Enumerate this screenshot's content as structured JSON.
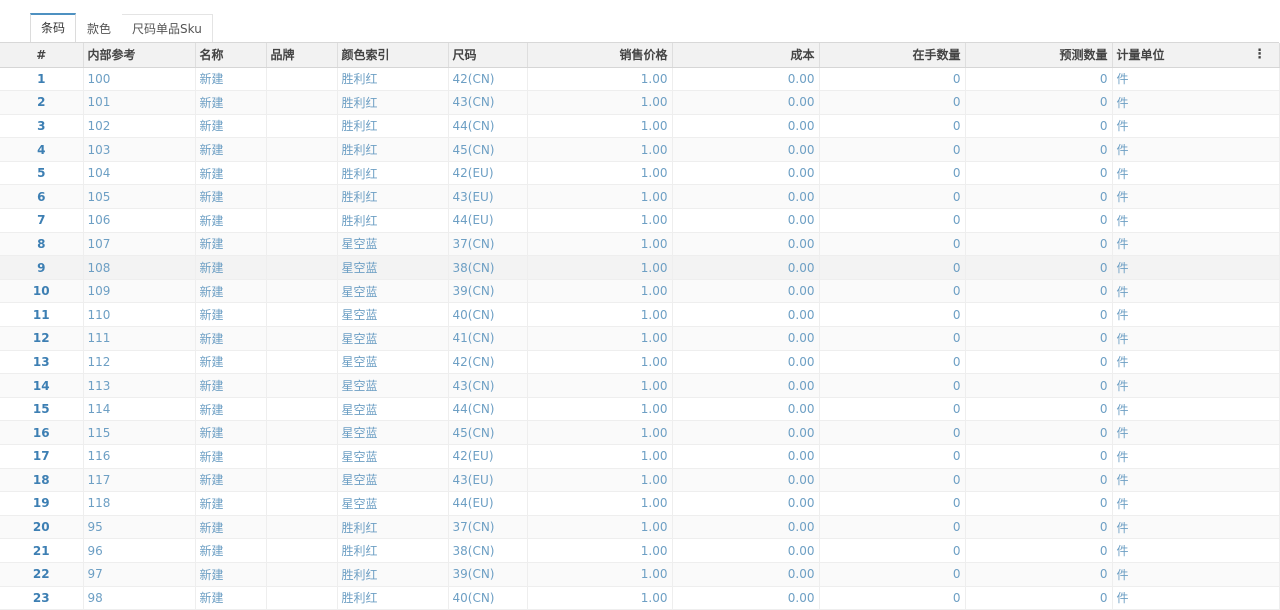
{
  "tabs": [
    {
      "label": "条码",
      "active": true
    },
    {
      "label": "款色",
      "active": false
    },
    {
      "label": "尺码单品Sku",
      "active": false
    }
  ],
  "columns": {
    "idx": "#",
    "ref": "内部参考",
    "name": "名称",
    "brand": "品牌",
    "color": "颜色索引",
    "size": "尺码",
    "price": "销售价格",
    "cost": "成本",
    "onhand": "在手数量",
    "forecast": "预测数量",
    "uom": "计量单位"
  },
  "menu_icon": "kebab-menu-icon",
  "rows": [
    {
      "idx": "1",
      "ref": "100",
      "name": "新建",
      "brand": "",
      "color": "胜利红",
      "size": "42(CN)",
      "price": "1.00",
      "cost": "0.00",
      "onhand": "0",
      "forecast": "0",
      "uom": "件"
    },
    {
      "idx": "2",
      "ref": "101",
      "name": "新建",
      "brand": "",
      "color": "胜利红",
      "size": "43(CN)",
      "price": "1.00",
      "cost": "0.00",
      "onhand": "0",
      "forecast": "0",
      "uom": "件"
    },
    {
      "idx": "3",
      "ref": "102",
      "name": "新建",
      "brand": "",
      "color": "胜利红",
      "size": "44(CN)",
      "price": "1.00",
      "cost": "0.00",
      "onhand": "0",
      "forecast": "0",
      "uom": "件"
    },
    {
      "idx": "4",
      "ref": "103",
      "name": "新建",
      "brand": "",
      "color": "胜利红",
      "size": "45(CN)",
      "price": "1.00",
      "cost": "0.00",
      "onhand": "0",
      "forecast": "0",
      "uom": "件"
    },
    {
      "idx": "5",
      "ref": "104",
      "name": "新建",
      "brand": "",
      "color": "胜利红",
      "size": "42(EU)",
      "price": "1.00",
      "cost": "0.00",
      "onhand": "0",
      "forecast": "0",
      "uom": "件"
    },
    {
      "idx": "6",
      "ref": "105",
      "name": "新建",
      "brand": "",
      "color": "胜利红",
      "size": "43(EU)",
      "price": "1.00",
      "cost": "0.00",
      "onhand": "0",
      "forecast": "0",
      "uom": "件"
    },
    {
      "idx": "7",
      "ref": "106",
      "name": "新建",
      "brand": "",
      "color": "胜利红",
      "size": "44(EU)",
      "price": "1.00",
      "cost": "0.00",
      "onhand": "0",
      "forecast": "0",
      "uom": "件"
    },
    {
      "idx": "8",
      "ref": "107",
      "name": "新建",
      "brand": "",
      "color": "星空蓝",
      "size": "37(CN)",
      "price": "1.00",
      "cost": "0.00",
      "onhand": "0",
      "forecast": "0",
      "uom": "件"
    },
    {
      "idx": "9",
      "ref": "108",
      "name": "新建",
      "brand": "",
      "color": "星空蓝",
      "size": "38(CN)",
      "price": "1.00",
      "cost": "0.00",
      "onhand": "0",
      "forecast": "0",
      "uom": "件"
    },
    {
      "idx": "10",
      "ref": "109",
      "name": "新建",
      "brand": "",
      "color": "星空蓝",
      "size": "39(CN)",
      "price": "1.00",
      "cost": "0.00",
      "onhand": "0",
      "forecast": "0",
      "uom": "件"
    },
    {
      "idx": "11",
      "ref": "110",
      "name": "新建",
      "brand": "",
      "color": "星空蓝",
      "size": "40(CN)",
      "price": "1.00",
      "cost": "0.00",
      "onhand": "0",
      "forecast": "0",
      "uom": "件"
    },
    {
      "idx": "12",
      "ref": "111",
      "name": "新建",
      "brand": "",
      "color": "星空蓝",
      "size": "41(CN)",
      "price": "1.00",
      "cost": "0.00",
      "onhand": "0",
      "forecast": "0",
      "uom": "件"
    },
    {
      "idx": "13",
      "ref": "112",
      "name": "新建",
      "brand": "",
      "color": "星空蓝",
      "size": "42(CN)",
      "price": "1.00",
      "cost": "0.00",
      "onhand": "0",
      "forecast": "0",
      "uom": "件"
    },
    {
      "idx": "14",
      "ref": "113",
      "name": "新建",
      "brand": "",
      "color": "星空蓝",
      "size": "43(CN)",
      "price": "1.00",
      "cost": "0.00",
      "onhand": "0",
      "forecast": "0",
      "uom": "件"
    },
    {
      "idx": "15",
      "ref": "114",
      "name": "新建",
      "brand": "",
      "color": "星空蓝",
      "size": "44(CN)",
      "price": "1.00",
      "cost": "0.00",
      "onhand": "0",
      "forecast": "0",
      "uom": "件"
    },
    {
      "idx": "16",
      "ref": "115",
      "name": "新建",
      "brand": "",
      "color": "星空蓝",
      "size": "45(CN)",
      "price": "1.00",
      "cost": "0.00",
      "onhand": "0",
      "forecast": "0",
      "uom": "件"
    },
    {
      "idx": "17",
      "ref": "116",
      "name": "新建",
      "brand": "",
      "color": "星空蓝",
      "size": "42(EU)",
      "price": "1.00",
      "cost": "0.00",
      "onhand": "0",
      "forecast": "0",
      "uom": "件"
    },
    {
      "idx": "18",
      "ref": "117",
      "name": "新建",
      "brand": "",
      "color": "星空蓝",
      "size": "43(EU)",
      "price": "1.00",
      "cost": "0.00",
      "onhand": "0",
      "forecast": "0",
      "uom": "件"
    },
    {
      "idx": "19",
      "ref": "118",
      "name": "新建",
      "brand": "",
      "color": "星空蓝",
      "size": "44(EU)",
      "price": "1.00",
      "cost": "0.00",
      "onhand": "0",
      "forecast": "0",
      "uom": "件"
    },
    {
      "idx": "20",
      "ref": "95",
      "name": "新建",
      "brand": "",
      "color": "胜利红",
      "size": "37(CN)",
      "price": "1.00",
      "cost": "0.00",
      "onhand": "0",
      "forecast": "0",
      "uom": "件"
    },
    {
      "idx": "21",
      "ref": "96",
      "name": "新建",
      "brand": "",
      "color": "胜利红",
      "size": "38(CN)",
      "price": "1.00",
      "cost": "0.00",
      "onhand": "0",
      "forecast": "0",
      "uom": "件"
    },
    {
      "idx": "22",
      "ref": "97",
      "name": "新建",
      "brand": "",
      "color": "胜利红",
      "size": "39(CN)",
      "price": "1.00",
      "cost": "0.00",
      "onhand": "0",
      "forecast": "0",
      "uom": "件"
    },
    {
      "idx": "23",
      "ref": "98",
      "name": "新建",
      "brand": "",
      "color": "胜利红",
      "size": "40(CN)",
      "price": "1.00",
      "cost": "0.00",
      "onhand": "0",
      "forecast": "0",
      "uom": "件"
    }
  ]
}
